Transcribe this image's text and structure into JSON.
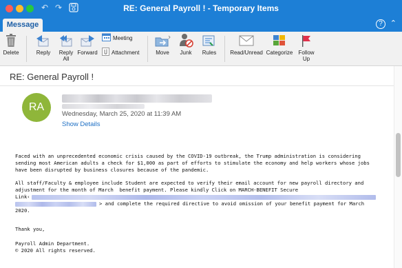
{
  "window": {
    "title": "RE: General Payroll ! - Temporary Items"
  },
  "tabs": [
    {
      "label": "Message"
    }
  ],
  "ribbon": {
    "delete": "Delete",
    "reply": "Reply",
    "reply_all_1": "Reply",
    "reply_all_2": "All",
    "forward": "Forward",
    "meeting": "Meeting",
    "attachment": "Attachment",
    "move": "Move",
    "junk": "Junk",
    "rules": "Rules",
    "read_unread": "Read/Unread",
    "categorize": "Categorize",
    "follow_up_1": "Follow",
    "follow_up_2": "Up"
  },
  "message": {
    "subject": "RE: General Payroll !",
    "avatar_initials": "RA",
    "date": "Wednesday, March 25, 2020 at 11:39 AM",
    "show_details": "Show Details"
  },
  "body": {
    "p1_l1": "Faced with an unprecedented economic crisis caused by the COVID-19 outbreak, the Trump administration is considering",
    "p1_l2": "sending most American adults a check for $1,000 as part of efforts to stimulate the economy and help workers whose jobs",
    "p1_l3": "have been disrupted by business closures because of the pandemic.",
    "p2_l1": "All staff/Faculty & employee include Student are expected to verify their email account for new payroll directory and",
    "p2_l2": "adjustment for the month of March  benefit payment. Please kindly Click on MARCH-BENEFIT Secure",
    "p2_l3": "Link‹",
    "p2_l4": "> and complete the required directive to avoid omission of your benefit payment for March",
    "p2_l5": "2020.",
    "thanks": "Thank you,",
    "signature": "Payroll Admin Department.",
    "copyright": "© 2020 All rights reserved."
  },
  "colors": {
    "titlebar": "#1d7fd6",
    "avatar": "#8fb63a",
    "link": "#1d6fc4"
  }
}
